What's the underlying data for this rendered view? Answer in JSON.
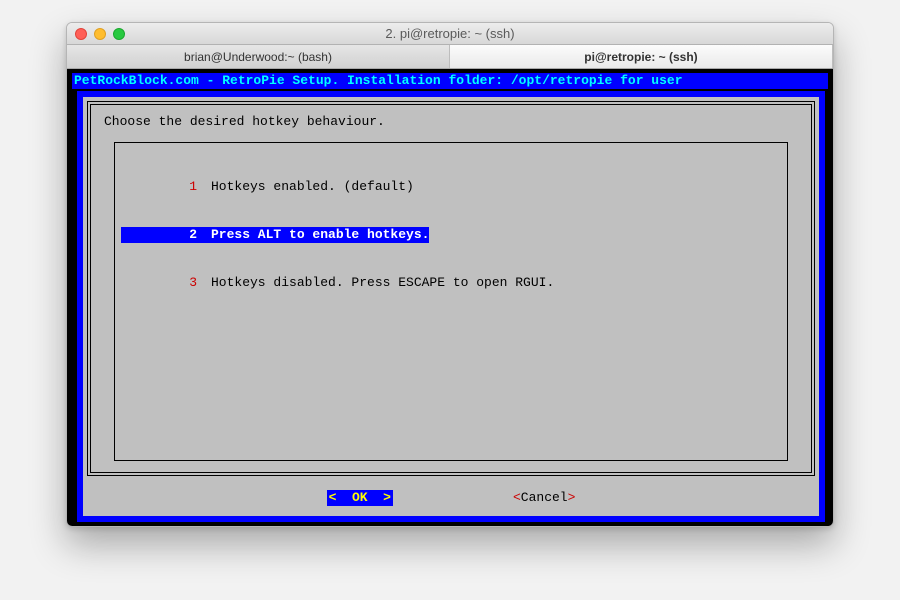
{
  "window": {
    "title": "2. pi@retropie: ~ (ssh)"
  },
  "tabs": [
    {
      "label": "brian@Underwood:~ (bash)",
      "active": false
    },
    {
      "label": "pi@retropie: ~ (ssh)",
      "active": true
    }
  ],
  "banner": "PetRockBlock.com - RetroPie Setup. Installation folder: /opt/retropie for user",
  "dialog": {
    "prompt": "Choose the desired hotkey behaviour.",
    "options": [
      {
        "num": "1",
        "label": "Hotkeys enabled. (default)",
        "selected": false
      },
      {
        "num": "2",
        "label": "Press ALT to enable hotkeys.",
        "selected": true
      },
      {
        "num": "3",
        "label": "Hotkeys disabled. Press ESCAPE to open RGUI.",
        "selected": false
      }
    ],
    "ok_label": "<  OK  >",
    "cancel_open": "<",
    "cancel_text": "Cancel",
    "cancel_close": ">"
  },
  "colors": {
    "blue": "#0000ff",
    "cyan": "#00ffff",
    "red": "#cc0000",
    "gray": "#c0c0c0",
    "yellow": "#ffff00"
  }
}
